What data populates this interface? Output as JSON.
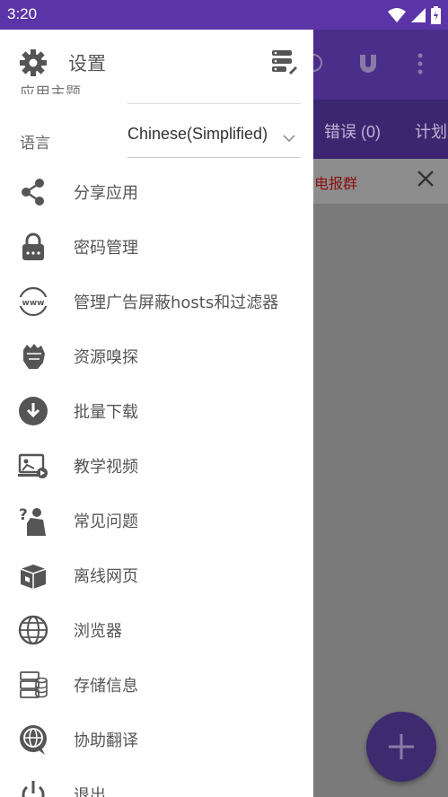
{
  "status_bar": {
    "time": "3:20"
  },
  "background": {
    "tabs": [
      "错误 (0)",
      "计划"
    ],
    "banner_text": "电报群"
  },
  "drawer": {
    "title": "设置",
    "partial_item_label": "应用主题",
    "language": {
      "label": "语言",
      "value": "Chinese(Simplified)"
    },
    "items": [
      {
        "label": "分享应用",
        "icon": "share-icon"
      },
      {
        "label": "密码管理",
        "icon": "lock-icon"
      },
      {
        "label": "管理广告屏蔽hosts和过滤器",
        "icon": "www-icon"
      },
      {
        "label": "资源嗅探",
        "icon": "fist-icon"
      },
      {
        "label": "批量下载",
        "icon": "download-icon"
      },
      {
        "label": "教学视频",
        "icon": "video-tutorial-icon"
      },
      {
        "label": "常见问题",
        "icon": "faq-icon"
      },
      {
        "label": "离线网页",
        "icon": "offline-box-icon"
      },
      {
        "label": "浏览器",
        "icon": "globe-icon"
      },
      {
        "label": "存储信息",
        "icon": "storage-icon"
      },
      {
        "label": "协助翻译",
        "icon": "translate-icon"
      },
      {
        "label": "退出",
        "icon": "power-icon"
      }
    ]
  },
  "colors": {
    "status_bar": "#5b34a8",
    "icon_gray": "#555555",
    "accent": "#3e2a6e"
  }
}
